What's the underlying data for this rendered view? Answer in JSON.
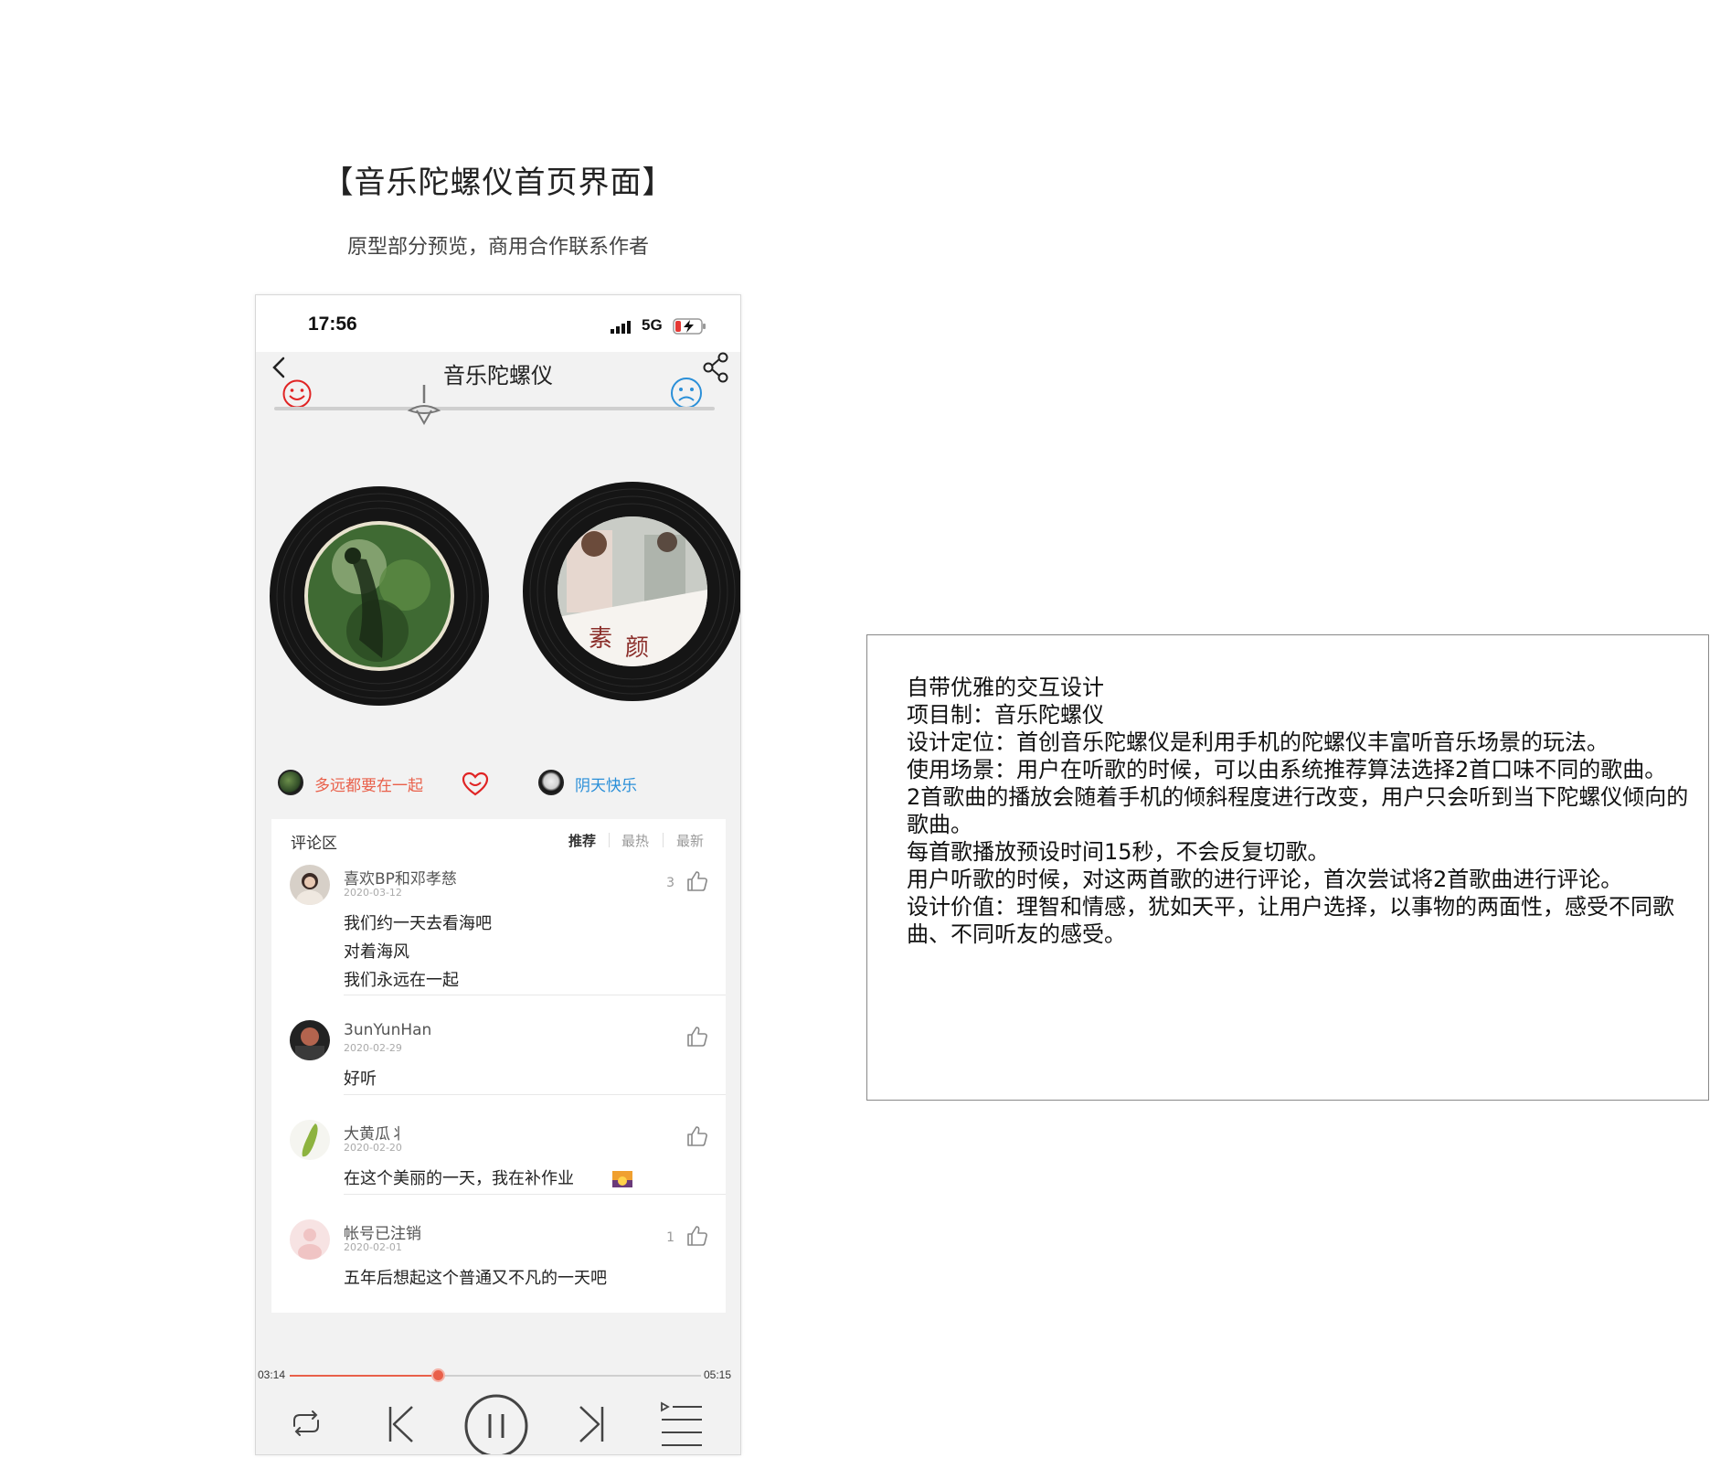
{
  "page": {
    "title": "【音乐陀螺仪首页界面】",
    "subtitle": "原型部分预览，商用合作联系作者"
  },
  "status_bar": {
    "time": "17:56",
    "network": "5G"
  },
  "nav": {
    "title": "音乐陀螺仪"
  },
  "songs": [
    {
      "name": "多远都要在一起",
      "liked": false,
      "accent": "#e9604a"
    },
    {
      "name": "阴天快乐",
      "liked": true,
      "accent": "#2a8fd8"
    }
  ],
  "comments_section": {
    "title": "评论区",
    "tabs": [
      "推荐",
      "最热",
      "最新"
    ],
    "active_tab": "推荐",
    "items": [
      {
        "user": "喜欢BP和邓孝慈",
        "date": "2020-03-12",
        "likes": "3",
        "lines": [
          "我们约一天去看海吧",
          "对着海风",
          "我们永远在一起"
        ]
      },
      {
        "user": "3unYunHan",
        "date": "2020-02-29",
        "likes": "",
        "lines": [
          "好听"
        ]
      },
      {
        "user": "大黄瓜丬",
        "date": "2020-02-20",
        "likes": "",
        "lines": [
          "在这个美丽的一天，我在补作业"
        ]
      },
      {
        "user": "帐号已注销",
        "date": "2020-02-01",
        "likes": "1",
        "lines": [
          "五年后想起这个普通又不凡的一天吧"
        ]
      }
    ]
  },
  "player": {
    "current_time": "03:14",
    "total_time": "05:15",
    "progress_fraction": 0.36
  },
  "description": {
    "lines": [
      "自带优雅的交互设计",
      "项目制：音乐陀螺仪",
      "设计定位：首创音乐陀螺仪是利用手机的陀螺仪丰富听音乐场景的玩法。",
      "使用场景：用户在听歌的时候，可以由系统推荐算法选择2首口味不同的歌曲。",
      "2首歌曲的播放会随着手机的倾斜程度进行改变，用户只会听到当下陀螺仪倾向的歌曲。",
      "每首歌播放预设时间15秒，不会反复切歌。",
      "用户听歌的时候，对这两首歌的进行评论，首次尝试将2首歌曲进行评论。",
      "设计价值：理智和情感，犹如天平，让用户选择，以事物的两面性，感受不同歌曲、不同听友的感受。"
    ]
  },
  "colors": {
    "accent_red": "#e9604a",
    "accent_blue": "#2a8fd8",
    "heart_red": "#e02424"
  }
}
